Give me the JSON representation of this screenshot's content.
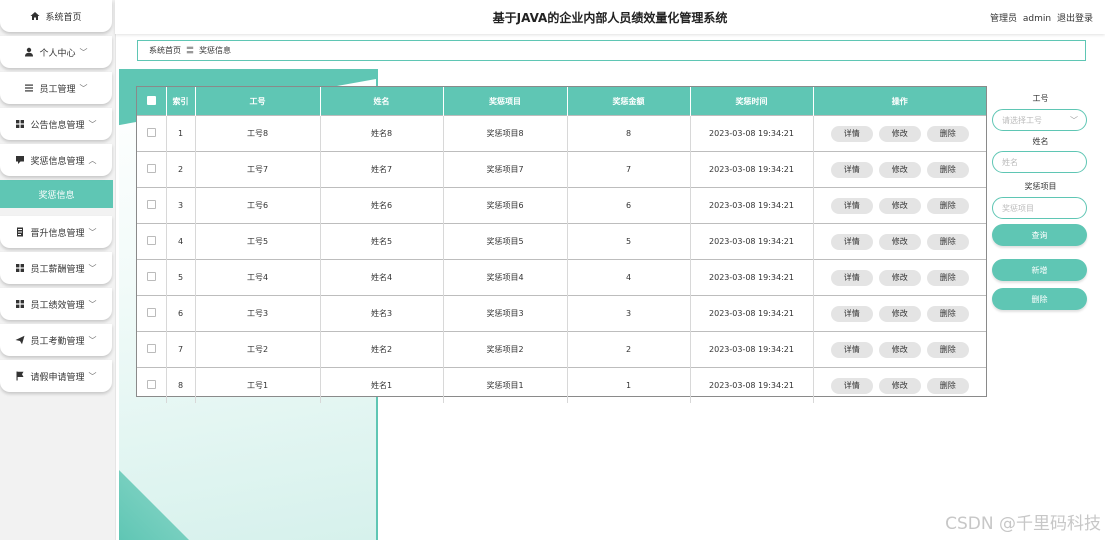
{
  "sidebar": {
    "items": [
      {
        "label": "系统首页",
        "icon": "home-icon",
        "chevron": ""
      },
      {
        "label": "个人中心",
        "icon": "user-icon",
        "chevron": "﹀"
      },
      {
        "label": "员工管理",
        "icon": "list-icon",
        "chevron": "﹀"
      },
      {
        "label": "公告信息管理",
        "icon": "grid-icon",
        "chevron": "﹀"
      },
      {
        "label": "奖惩信息管理",
        "icon": "chat-icon",
        "chevron": "︿"
      }
    ],
    "sub_active": "奖惩信息",
    "items_after": [
      {
        "label": "晋升信息管理",
        "icon": "doc-icon",
        "chevron": "﹀"
      },
      {
        "label": "员工薪酬管理",
        "icon": "grid-icon",
        "chevron": "﹀"
      },
      {
        "label": "员工绩效管理",
        "icon": "grid-icon",
        "chevron": "﹀"
      },
      {
        "label": "员工考勤管理",
        "icon": "send-icon",
        "chevron": "﹀"
      },
      {
        "label": "请假申请管理",
        "icon": "flag-icon",
        "chevron": "﹀"
      }
    ]
  },
  "header": {
    "title": "基于JAVA的企业内部人员绩效量化管理系统",
    "role": "管理员",
    "username": "admin",
    "logout": "退出登录"
  },
  "breadcrumb": {
    "home": "系统首页",
    "separator": "〓",
    "current": "奖惩信息"
  },
  "table": {
    "columns": [
      "索引",
      "工号",
      "姓名",
      "奖惩项目",
      "奖惩金额",
      "奖惩时间",
      "操作"
    ],
    "rows": [
      {
        "index": "1",
        "emp_no": "工号8",
        "name": "姓名8",
        "item": "奖惩项目8",
        "amount": "8",
        "time": "2023-03-08 19:34:21"
      },
      {
        "index": "2",
        "emp_no": "工号7",
        "name": "姓名7",
        "item": "奖惩项目7",
        "amount": "7",
        "time": "2023-03-08 19:34:21"
      },
      {
        "index": "3",
        "emp_no": "工号6",
        "name": "姓名6",
        "item": "奖惩项目6",
        "amount": "6",
        "time": "2023-03-08 19:34:21"
      },
      {
        "index": "4",
        "emp_no": "工号5",
        "name": "姓名5",
        "item": "奖惩项目5",
        "amount": "5",
        "time": "2023-03-08 19:34:21"
      },
      {
        "index": "5",
        "emp_no": "工号4",
        "name": "姓名4",
        "item": "奖惩项目4",
        "amount": "4",
        "time": "2023-03-08 19:34:21"
      },
      {
        "index": "6",
        "emp_no": "工号3",
        "name": "姓名3",
        "item": "奖惩项目3",
        "amount": "3",
        "time": "2023-03-08 19:34:21"
      },
      {
        "index": "7",
        "emp_no": "工号2",
        "name": "姓名2",
        "item": "奖惩项目2",
        "amount": "2",
        "time": "2023-03-08 19:34:21"
      },
      {
        "index": "8",
        "emp_no": "工号1",
        "name": "姓名1",
        "item": "奖惩项目1",
        "amount": "1",
        "time": "2023-03-08 19:34:21"
      }
    ],
    "actions": {
      "detail": "详情",
      "edit": "修改",
      "delete": "删除"
    }
  },
  "search": {
    "emp_no_label": "工号",
    "emp_no_placeholder": "请选择工号",
    "name_label": "姓名",
    "name_placeholder": "姓名",
    "item_label": "奖惩项目",
    "item_placeholder": "奖惩项目",
    "query_button": "查询",
    "add_button": "新增",
    "delete_button": "删除"
  },
  "watermark": "CSDN @千里码科技",
  "colors": {
    "accent": "#5fc6b4"
  }
}
